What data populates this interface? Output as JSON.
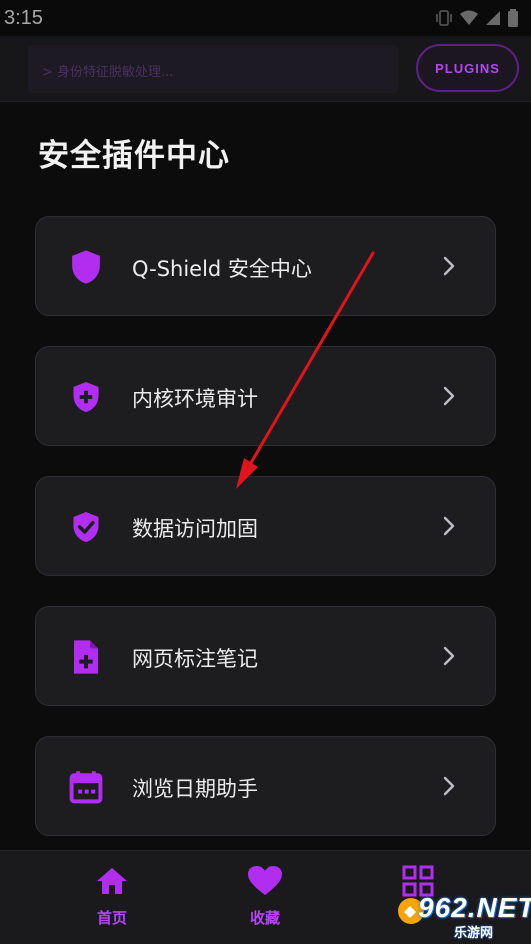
{
  "status_bar": {
    "time": "3:15"
  },
  "toolbar": {
    "log_text": "> 身份特征脱敏处理...",
    "plugins_label": "PLUGINS"
  },
  "page": {
    "title": "安全插件中心"
  },
  "plugins": [
    {
      "label": "Q-Shield 安全中心",
      "icon": "shield-icon"
    },
    {
      "label": "内核环境审计",
      "icon": "shield-plus-icon"
    },
    {
      "label": "数据访问加固",
      "icon": "shield-check-icon"
    },
    {
      "label": "网页标注笔记",
      "icon": "file-plus-icon"
    },
    {
      "label": "浏览日期助手",
      "icon": "calendar-icon"
    }
  ],
  "bottom_nav": {
    "items": [
      {
        "label": "首页",
        "icon": "home-icon"
      },
      {
        "label": "收藏",
        "icon": "heart-icon"
      },
      {
        "label": "",
        "icon": "grid-icon"
      }
    ]
  },
  "watermark": {
    "brand": "962.NET",
    "sub": "乐游网"
  },
  "colors": {
    "accent": "#b12ef0",
    "background": "#0c0c0d",
    "card": "#1d1d20",
    "annotation_arrow": "#e0141c"
  }
}
